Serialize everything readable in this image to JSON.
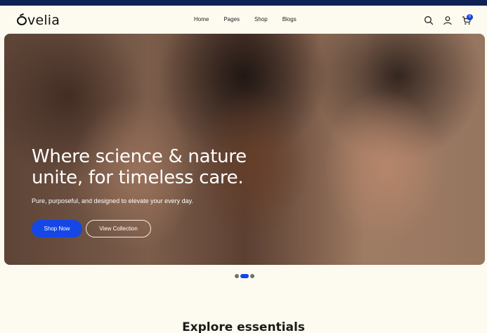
{
  "brand": {
    "logo_text": "velia",
    "logo_full": "ovelia"
  },
  "nav": {
    "items": [
      {
        "label": "Home"
      },
      {
        "label": "Pages"
      },
      {
        "label": "Shop"
      },
      {
        "label": "Blogs"
      }
    ]
  },
  "header_icons": [
    "search-icon",
    "user-icon",
    "cart-icon"
  ],
  "cart": {
    "count": "0"
  },
  "hero": {
    "title": "Where science & nature unite, for timeless care.",
    "subtitle": "Pure, purposeful, and designed to elevate your every day.",
    "primary_button": "Shop Now",
    "secondary_button": "View Collection"
  },
  "carousel": {
    "slides": 3,
    "active_index": 1
  },
  "section": {
    "title": "Explore essentials"
  },
  "colors": {
    "accent": "#1447e6",
    "background": "#fdfbef",
    "topbar": "#0e2254"
  }
}
